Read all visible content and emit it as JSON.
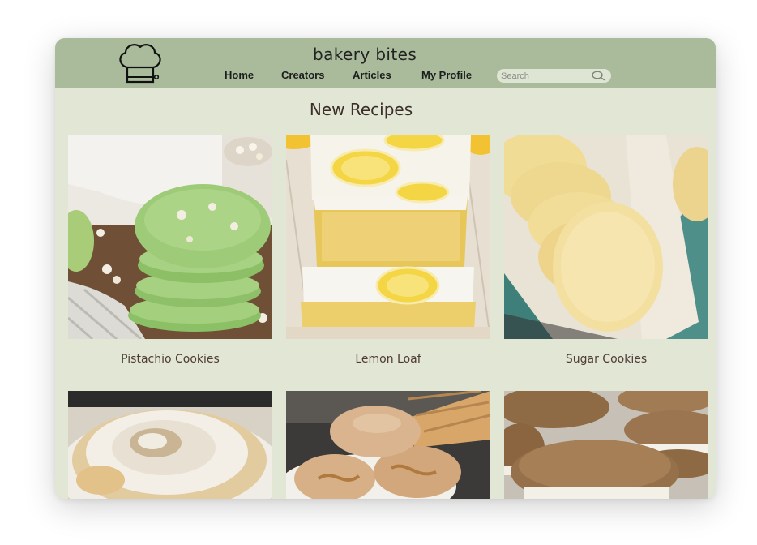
{
  "header": {
    "brand": "bakery bites",
    "nav": [
      "Home",
      "Creators",
      "Articles",
      "My Profile"
    ],
    "search_placeholder": "Search"
  },
  "main": {
    "section_title": "New Recipes",
    "recipes": [
      {
        "title": "Pistachio Cookies"
      },
      {
        "title": "Lemon Loaf"
      },
      {
        "title": "Sugar Cookies"
      },
      {
        "title": ""
      },
      {
        "title": ""
      },
      {
        "title": ""
      }
    ]
  },
  "colors": {
    "header_bg": "#a9bb9b",
    "page_bg": "#e2e6d5",
    "title_text": "#3b2e28"
  },
  "icons": [
    "chef-hat-icon",
    "search-icon"
  ]
}
